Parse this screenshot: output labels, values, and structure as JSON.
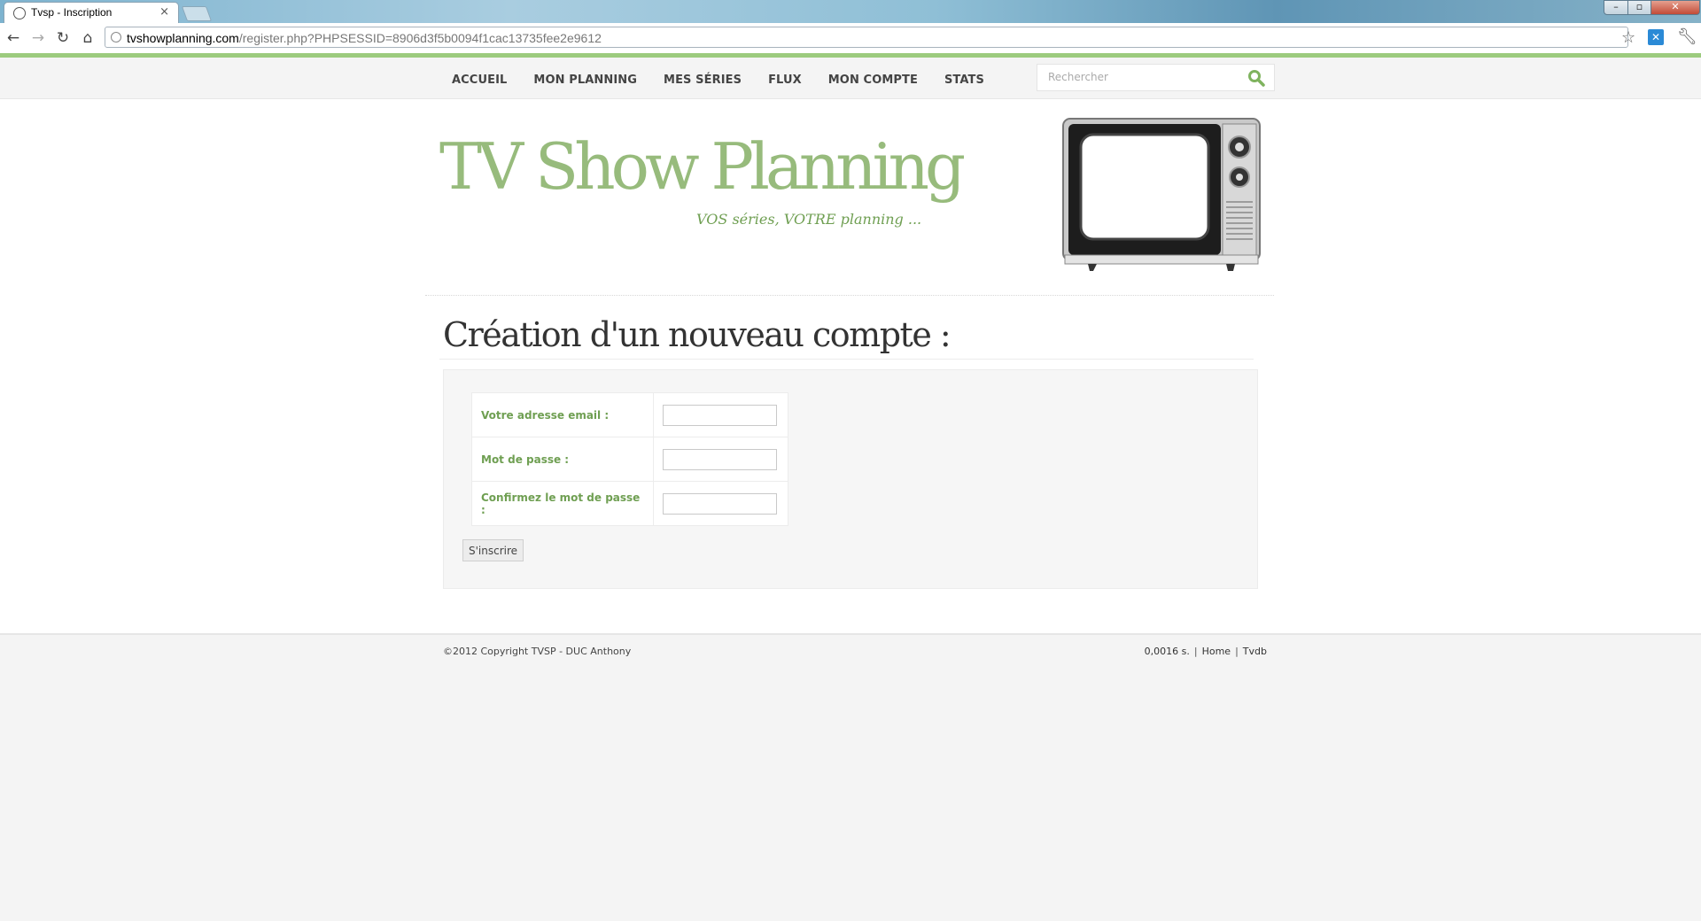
{
  "browser": {
    "tab_title": "Tvsp - Inscription",
    "tab_close": "×",
    "url_host": "tvshowplanning.com",
    "url_path": "/register.php?PHPSESSID=8906d3f5b0094f1cac13735fee2e9612",
    "icons": [
      "back-icon",
      "forward-icon",
      "reload-icon",
      "home-icon",
      "star-icon",
      "wrench-icon"
    ]
  },
  "nav": {
    "items": [
      "ACCUEIL",
      "MON PLANNING",
      "MES SÉRIES",
      "FLUX",
      "MON COMPTE",
      "STATS"
    ],
    "search_placeholder": "Rechercher"
  },
  "header": {
    "logo": "TV Show Planning",
    "tagline": "VOS séries, VOTRE planning ..."
  },
  "main": {
    "title": "Création d'un nouveau compte :",
    "fields": [
      {
        "label": "Votre adresse email :",
        "value": ""
      },
      {
        "label": "Mot de passe :",
        "value": ""
      },
      {
        "label": "Confirmez le mot de passe :",
        "value": ""
      }
    ],
    "submit_label": "S'inscrire"
  },
  "footer": {
    "copyright": "©2012 Copyright TVSP - DUC Anthony",
    "time": "0,0016 s.",
    "link_home": "Home",
    "link_tvdb": "Tvdb",
    "separator": "|"
  },
  "colors": {
    "accent_green": "#97bb7c",
    "label_green": "#6f9f52"
  }
}
